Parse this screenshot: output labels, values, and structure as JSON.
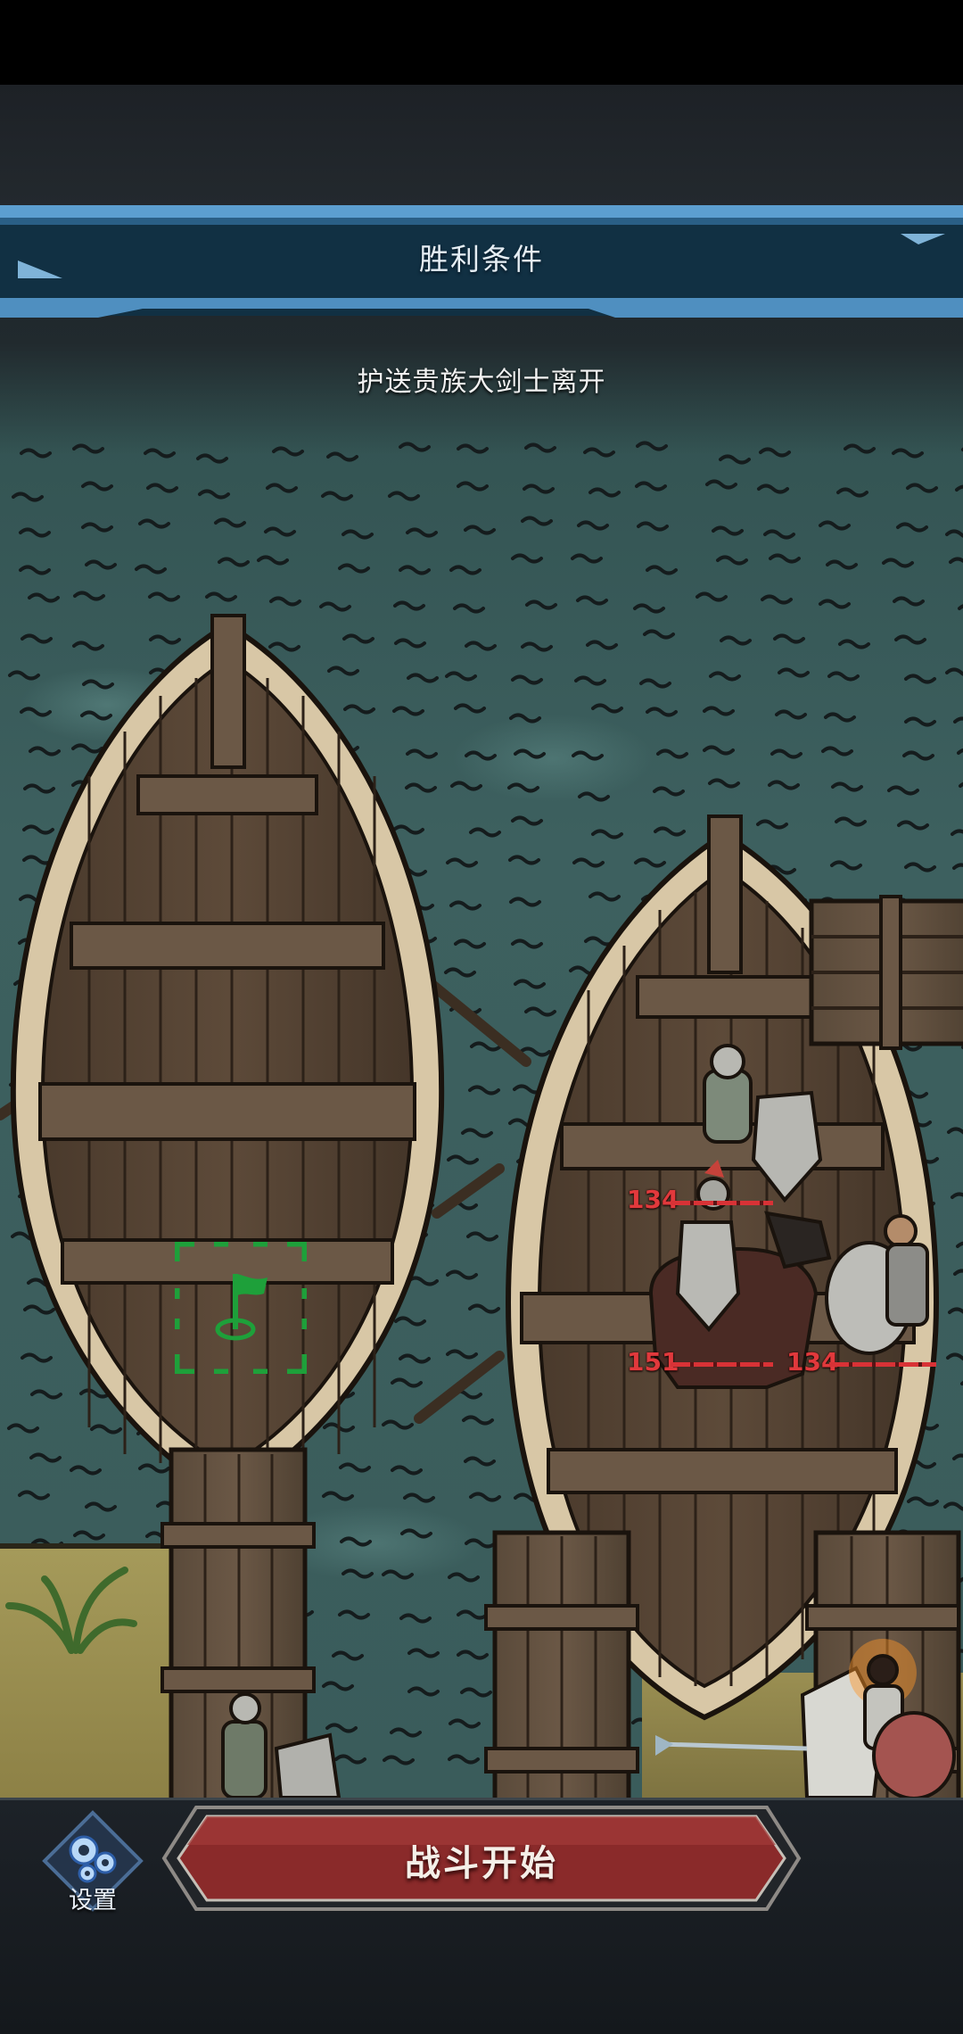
{
  "banner": {
    "title": "胜利条件"
  },
  "objective": {
    "text": "护送贵族大剑士离开"
  },
  "units": [
    {
      "hp": "134"
    },
    {
      "hp": "151"
    },
    {
      "hp": "134"
    }
  ],
  "actions": {
    "start_battle_label": "战斗开始",
    "settings_label": "设置"
  },
  "icons": {
    "settings": "gear-icon",
    "target": "flag-icon"
  },
  "colors": {
    "banner_blue": "#4f8fc0",
    "hp_red": "#e1393c",
    "start_button_red": "#8a2a2a",
    "target_green": "#1ea03a"
  }
}
